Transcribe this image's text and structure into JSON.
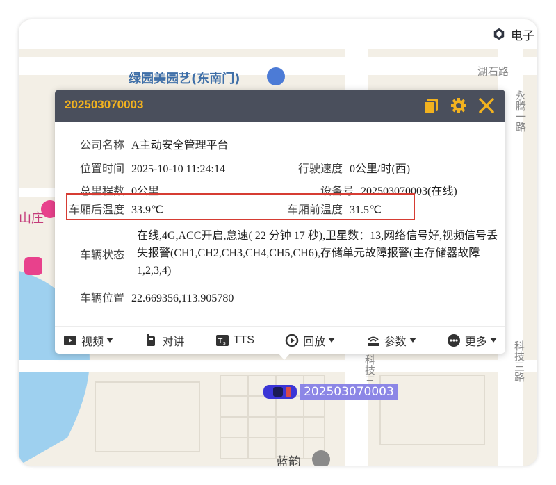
{
  "topbar": {
    "label": "电子"
  },
  "map": {
    "poi_top": "绿园美园艺(东南门)",
    "poi_left": "山庄",
    "poi_bottom": "蓝韵",
    "road_right": "永腾一路",
    "road_keji": "科技三路",
    "road_keji2": "科技三路",
    "road_upper_right": "湖石路"
  },
  "vehicle": {
    "plate": "202503070003"
  },
  "popup": {
    "title": "202503070003",
    "rows": {
      "company_label": "公司名称",
      "company_value": "A主动安全管理平台",
      "time_label": "位置时间",
      "time_value": "2025-10-10 11:24:14",
      "speed_label": "行驶速度",
      "speed_value": "0公里/时(西)",
      "mileage_label": "总里程数",
      "mileage_value": "0公里",
      "device_label": "设备号",
      "device_value": "202503070003(在线)",
      "rear_temp_label": "车厢后温度",
      "rear_temp_value": "33.9℃",
      "front_temp_label": "车厢前温度",
      "front_temp_value": "31.5℃",
      "status_label": "车辆状态",
      "status_value": "在线,4G,ACC开启,怠速( 22 分钟 17 秒),卫星数：13,网络信号好,视频信号丢失报警(CH1,CH2,CH3,CH4,CH5,CH6),存储单元故障报警(主存储器故障1,2,3,4)",
      "position_label": "车辆位置",
      "position_value": "22.669356,113.905780"
    },
    "toolbar": {
      "video": "视频",
      "intercom": "对讲",
      "tts": "TTS",
      "playback": "回放",
      "params": "参数",
      "more": "更多"
    }
  },
  "colors": {
    "header_bg": "#4a4f5c",
    "title": "#f2b21f",
    "highlight": "#d63c33",
    "plate_bg": "#8c86e6"
  }
}
